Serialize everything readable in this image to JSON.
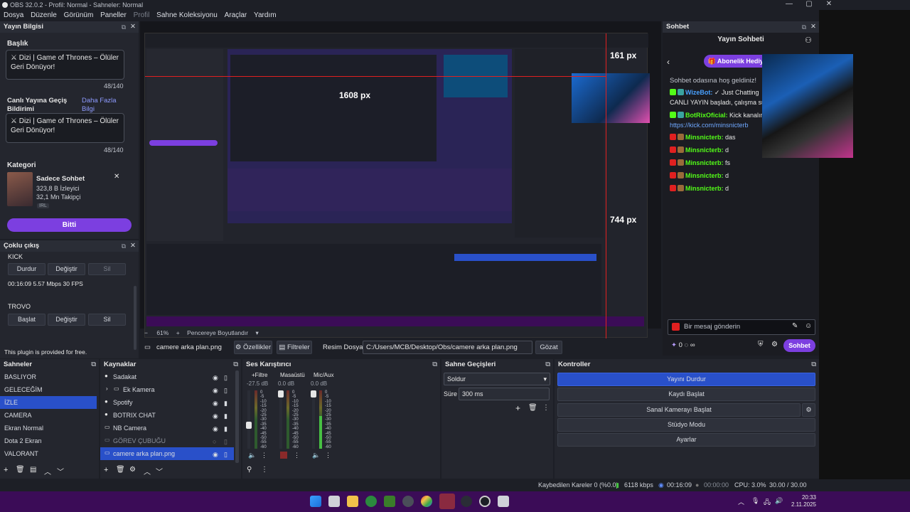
{
  "window": {
    "title": "OBS 32.0.2 - Profil: Normal - Sahneler: Normal",
    "min": "—",
    "max": "▢",
    "close": "✕"
  },
  "menu": [
    "Dosya",
    "Düzenle",
    "Görünüm",
    "Paneller",
    "Profil",
    "Sahne Koleksiyonu",
    "Araçlar",
    "Yardım"
  ],
  "yayin": {
    "title": "Yayın Bilgisi",
    "baslik_label": "Başlık",
    "baslik_value": "⚔ Dizi | Game of Thrones – Ölüler Geri Dönüyor!",
    "baslik_count": "48/140",
    "canli_label": "Canlı Yayına Geçiş Bildirimi",
    "canli_more": "Daha Fazla Bilgi",
    "canli_value": "⚔ Dizi | Game of Thrones – Ölüler Geri Dönüyor!",
    "canli_count": "48/140",
    "kategori_label": "Kategori",
    "kategori_name": "Sadece Sohbet",
    "kategori_viewers": "323,8 B İzleyici",
    "kategori_followers": "32,1 Mn Takipçi",
    "kategori_tag": "IRL",
    "bitti": "Bitti"
  },
  "coklu": {
    "title": "Çoklu çıkış",
    "kick": "KICK",
    "kick_btns": [
      "Durdur",
      "Değiştir",
      "Sil"
    ],
    "kick_stats": "00:16:09  5.57 Mbps  30 FPS",
    "trovo": "TROVO",
    "trovo_btns": [
      "Başlat",
      "Değiştir",
      "Sil"
    ],
    "note": "This plugin is provided for free."
  },
  "preview": {
    "zoom": "61%",
    "fit": "Pencereye Boyutlandır",
    "label_161": "161 px",
    "label_1608": "1608 px",
    "label_744": "744 px"
  },
  "sourcebar": {
    "name": "camere arka plan.png",
    "props": "Özellikler",
    "filters": "Filtreler",
    "file_label": "Resim Dosyası",
    "file_path": "C:/Users/MCB/Desktop/Obs/camere arka plan.png",
    "browse": "Gözat"
  },
  "chat": {
    "dock_title": "Sohbet",
    "header": "Yayın Sohbeti",
    "gift": "Abonelik Hediye Et",
    "welcome": "Sohbet odasına hoş geldiniz!",
    "lines": [
      {
        "user": "WizeBot:",
        "text": " ✓ Just Chatting",
        "color": "#48a0ff"
      },
      {
        "user": "",
        "text": "CANLI YAYIN başladı, çalışma sür",
        "color": "#e6e6e6"
      },
      {
        "user": "BotRixOficial:",
        "text": " Kick kanalım",
        "color": "#53fc18"
      },
      {
        "user": "",
        "text": "https://kick.com/minsnicterb",
        "color": "#6fa8ff"
      },
      {
        "user": "Minsnicterb:",
        "text": " das",
        "color": "#53fc18"
      },
      {
        "user": "Minsnicterb:",
        "text": " d",
        "color": "#53fc18"
      },
      {
        "user": "Minsnicterb:",
        "text": " fs",
        "color": "#53fc18"
      },
      {
        "user": "Minsnicterb:",
        "text": " d",
        "color": "#53fc18"
      },
      {
        "user": "Minsnicterb:",
        "text": " d",
        "color": "#53fc18"
      }
    ],
    "placeholder": "Bir mesaj gönderin",
    "points": "0",
    "send": "Sohbet"
  },
  "scenes": {
    "title": "Sahneler",
    "items": [
      "BASLIYOR",
      "GELECEĞİM",
      "İZLE",
      "CAMERA",
      "Ekran Normal",
      "Dota 2 Ekran",
      "VALORANT"
    ],
    "selected": 2
  },
  "sources": {
    "title": "Kaynaklar",
    "items": [
      "Sadakat",
      "Ek Kamera",
      "Spotify",
      "BOTRIX CHAT",
      "NB Camera",
      "GÖREV ÇUBUĞU",
      "camere arka plan.png"
    ],
    "selected": 6
  },
  "mixer": {
    "title": "Ses Karıştırıcı",
    "channels": [
      {
        "name": "+Filtre",
        "db": "-27.5 dB",
        "level": 0.35
      },
      {
        "name": "Masaüstü",
        "db": "0.0 dB",
        "level": 0.0
      },
      {
        "name": "Mic/Aux",
        "db": "0.0 dB",
        "level": 0.55
      }
    ],
    "scale": [
      "0",
      "-5",
      "-10",
      "-15",
      "-20",
      "-25",
      "-30",
      "-35",
      "-40",
      "-45",
      "-50",
      "-55",
      "-60"
    ]
  },
  "transitions": {
    "title": "Sahne Geçişleri",
    "type": "Soldur",
    "duration_label": "Süre",
    "duration": "300 ms"
  },
  "controls": {
    "title": "Kontroller",
    "buttons": [
      "Yayını Durdur",
      "Kaydı Başlat",
      "Sanal Kamerayı Başlat",
      "Stüdyo Modu",
      "Ayarlar"
    ]
  },
  "status": {
    "dropped": "Kaybedilen Kareler 0 (%0.0)",
    "bitrate": "6118 kbps",
    "live": "00:16:09",
    "rec": "00:00:00",
    "cpu": "CPU: 3.0%",
    "fps": "30.00 / 30.00 FPS"
  },
  "clock": {
    "time": "20:33",
    "date": "2.11.2025"
  }
}
